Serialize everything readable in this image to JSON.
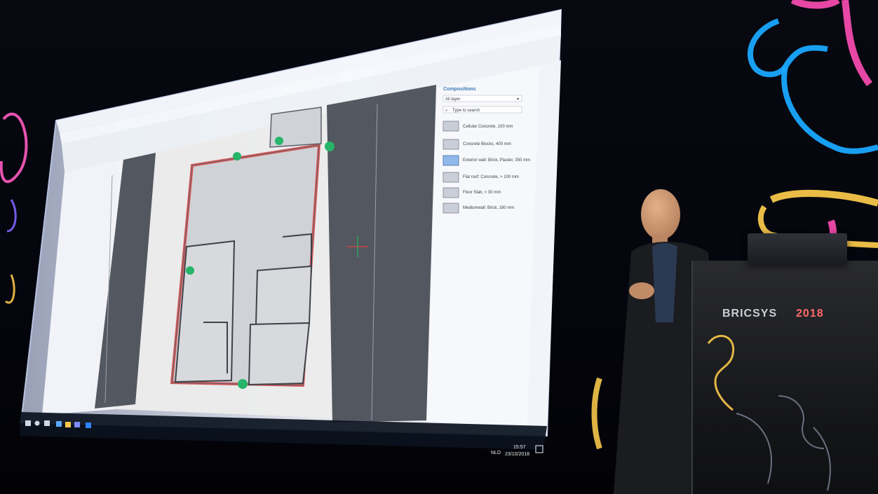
{
  "panel": {
    "title": "Compositions",
    "filter_value": "All layer",
    "search_placeholder": "Type to search",
    "items": [
      "Cellular Concrete, 100 mm",
      "Concrete Blocks, 400 mm",
      "Exterior wall: Brick, Plaster, 350 mm",
      "Flat roof: Concrete, > 100 mm",
      "Floor Slab, > 30 mm",
      "Mediumwall: Brick, 180 mm"
    ]
  },
  "taskbar": {
    "lang": "NLD",
    "time": "15:57",
    "date": "23/10/2018"
  },
  "podium": {
    "brand_a": "BRICSYS",
    "brand_b": "2018"
  },
  "colors": {
    "screen_bg": "#f7f9fc",
    "screen_glow": "#eef2ff",
    "toolbar": "#eef2f7",
    "panel_accent": "#3f78b7",
    "wall_red": "#d95a5a",
    "dark_stage": "#05060d",
    "neon_blue": "#19a8ff",
    "neon_cyan": "#2fc2ff",
    "neon_magenta": "#ff4fb5",
    "neon_yellow": "#f7c64a",
    "podium": "#1a1b1d"
  }
}
